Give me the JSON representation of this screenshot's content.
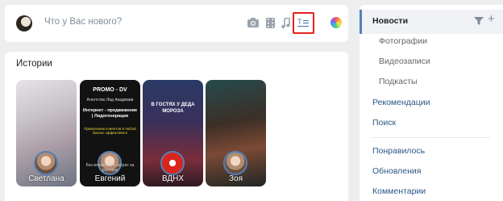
{
  "post": {
    "placeholder": "Что у Вас нового?"
  },
  "toolbar": {
    "icons": [
      "camera-icon",
      "video-icon",
      "music-icon",
      "article-icon",
      "color-picker-icon"
    ],
    "highlight_color": "#e3201c"
  },
  "stories": {
    "title": "Истории",
    "items": [
      {
        "name": "Светлана"
      },
      {
        "name": "Евгений",
        "title": "PROMO - DV",
        "subtitle": "Агентство Лид Академии",
        "text": "Интернет - продвижение | Лидогенерация",
        "yellow": "Привлекаем клиентов в любой бизнес эффективно!",
        "footer": "Без вложений и затрат на рекламу"
      },
      {
        "name": "ВДНХ",
        "text": "В ГОСТЯХ У ДЕДА МОРОЗА"
      },
      {
        "name": "Зоя"
      }
    ]
  },
  "nav": {
    "news": "Новости",
    "photos": "Фотографии",
    "videos": "Видеозаписи",
    "podcasts": "Подкасты",
    "recommendations": "Рекомендации",
    "search": "Поиск",
    "liked": "Понравилось",
    "updates": "Обновления",
    "comments": "Комментарии"
  },
  "colors": {
    "accent": "#5181b8",
    "link": "#2a5885",
    "background": "#edeef0"
  }
}
